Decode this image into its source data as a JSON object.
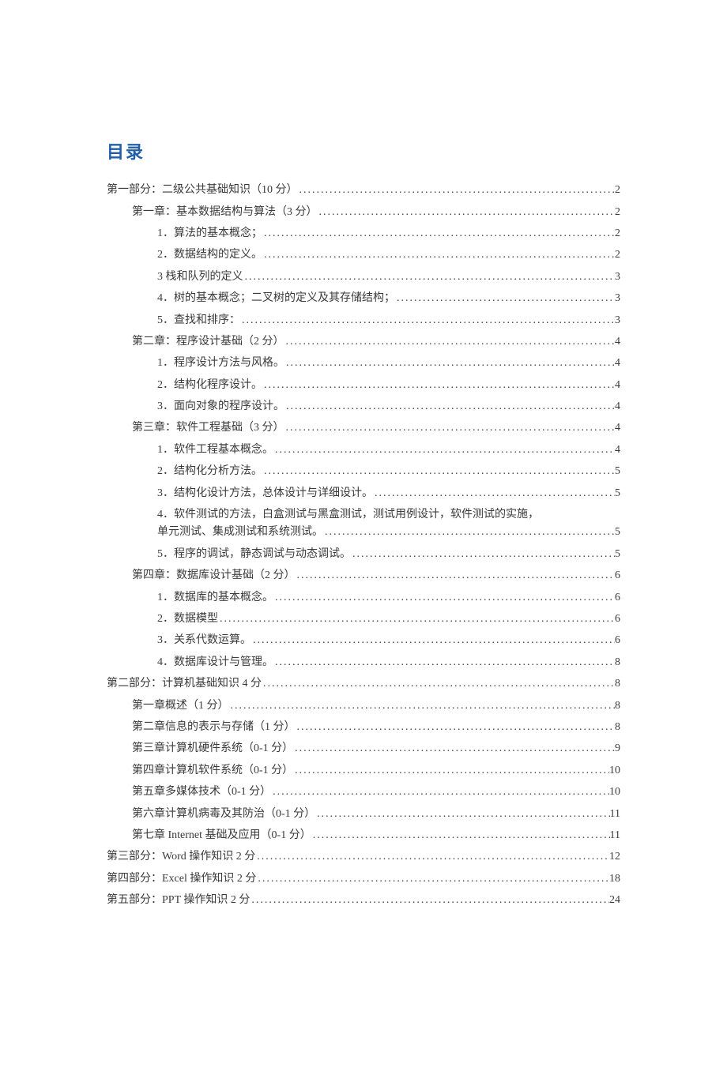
{
  "title": "目录",
  "toc": [
    {
      "level": 0,
      "label": "第一部分：二级公共基础知识（10 分）",
      "page": "2"
    },
    {
      "level": 1,
      "label": "第一章：基本数据结构与算法（3 分）",
      "page": "2"
    },
    {
      "level": 2,
      "label": "1．算法的基本概念；",
      "page": "2"
    },
    {
      "level": 2,
      "label": "2．数据结构的定义。",
      "page": "2"
    },
    {
      "level": 2,
      "label": "3 栈和队列的定义",
      "page": "3"
    },
    {
      "level": 2,
      "label": "4．树的基本概念；二叉树的定义及其存储结构；",
      "page": "3"
    },
    {
      "level": 2,
      "label": "5．查找和排序：",
      "page": "3"
    },
    {
      "level": 1,
      "label": "第二章：程序设计基础（2 分）",
      "page": "4"
    },
    {
      "level": 2,
      "label": "1．程序设计方法与风格。",
      "page": "4"
    },
    {
      "level": 2,
      "label": "2．结构化程序设计。",
      "page": "4"
    },
    {
      "level": 2,
      "label": "3．面向对象的程序设计。",
      "page": "4"
    },
    {
      "level": 1,
      "label": "第三章：软件工程基础（3 分）",
      "page": "4"
    },
    {
      "level": 2,
      "label": "1．软件工程基本概念。",
      "page": "4"
    },
    {
      "level": 2,
      "label": "2．结构化分析方法。",
      "page": "5"
    },
    {
      "level": 2,
      "label": "3．结构化设计方法，总体设计与详细设计。",
      "page": "5"
    },
    {
      "level": 2,
      "label_wrap_1": "4．软件测试的方法，白盒测试与黑盒测试，测试用例设计，软件测试的实施，",
      "label_wrap_2": "单元测试、集成测试和系统测试。",
      "page": "5",
      "wrap": true
    },
    {
      "level": 2,
      "label": "5．程序的调试，静态调试与动态调试。",
      "page": "5"
    },
    {
      "level": 1,
      "label": "第四章：数据库设计基础（2 分）",
      "page": "6"
    },
    {
      "level": 2,
      "label": "1．数据库的基本概念。",
      "page": "6"
    },
    {
      "level": 2,
      "label": "2．数据模型",
      "page": "6"
    },
    {
      "level": 2,
      "label": "3．关系代数运算。",
      "page": "6"
    },
    {
      "level": 2,
      "label": "4．数据库设计与管理。",
      "page": "8"
    },
    {
      "level": 0,
      "label": "第二部分：计算机基础知识 4 分",
      "page": "8"
    },
    {
      "level": 1,
      "label": "第一章概述（1 分）",
      "page": "8"
    },
    {
      "level": 1,
      "label": "第二章信息的表示与存储（1 分）",
      "page": "8"
    },
    {
      "level": 1,
      "label": "第三章计算机硬件系统（0-1 分）",
      "page": "9"
    },
    {
      "level": 1,
      "label": "第四章计算机软件系统（0-1 分）",
      "page": "10"
    },
    {
      "level": 1,
      "label": "第五章多媒体技术（0-1 分）",
      "page": "10"
    },
    {
      "level": 1,
      "label": "第六章计算机病毒及其防治（0-1 分）",
      "page": "11"
    },
    {
      "level": 1,
      "label": "第七章 Internet 基础及应用（0-1 分）",
      "page": "11"
    },
    {
      "level": 0,
      "label": "第三部分：Word 操作知识 2 分",
      "page": "12"
    },
    {
      "level": 0,
      "label": "第四部分：Excel 操作知识 2 分",
      "page": "18"
    },
    {
      "level": 0,
      "label": "第五部分：PPT 操作知识 2 分",
      "page": "24"
    }
  ]
}
